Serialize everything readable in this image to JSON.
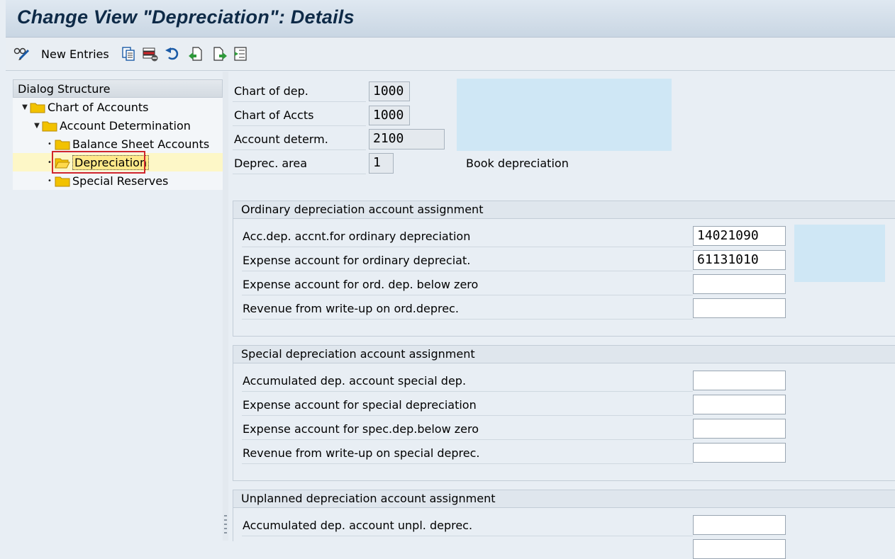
{
  "window": {
    "title": "Change View \"Depreciation\": Details"
  },
  "toolbar": {
    "new_entries_label": "New Entries",
    "icons": [
      "glasses-pencil-icon",
      "copy-icon",
      "delete-icon",
      "undo-icon",
      "export-icon",
      "previous-entry-icon",
      "next-entry-icon",
      "select-block-icon"
    ]
  },
  "tree": {
    "header": "Dialog Structure",
    "items": [
      {
        "label": "Chart of Accounts",
        "level": 0
      },
      {
        "label": "Account Determination",
        "level": 1
      },
      {
        "label": "Balance Sheet Accounts",
        "level": 2
      },
      {
        "label": "Depreciation",
        "level": 2,
        "selected": true
      },
      {
        "label": "Special Reserves",
        "level": 2
      }
    ]
  },
  "header_fields": {
    "chart_of_dep": {
      "label": "Chart of dep.",
      "value": "1000"
    },
    "chart_of_accts": {
      "label": "Chart of Accts",
      "value": "1000"
    },
    "account_determ": {
      "label": "Account determ.",
      "value": "2100"
    },
    "deprec_area": {
      "label": "Deprec. area",
      "value": "1",
      "description": "Book depreciation"
    }
  },
  "ordinary": {
    "title": "Ordinary depreciation account assignment",
    "rows": [
      {
        "label": "Acc.dep. accnt.for ordinary depreciation",
        "value": "14021090"
      },
      {
        "label": "Expense account for ordinary depreciat.",
        "value": "61131010"
      },
      {
        "label": "Expense account for ord. dep. below zero",
        "value": ""
      },
      {
        "label": "Revenue from write-up on ord.deprec.",
        "value": ""
      }
    ]
  },
  "special": {
    "title": "Special depreciation account assignment",
    "rows": [
      {
        "label": "Accumulated dep. account special dep.",
        "value": ""
      },
      {
        "label": "Expense account for special depreciation",
        "value": ""
      },
      {
        "label": "Expense account for spec.dep.below zero",
        "value": ""
      },
      {
        "label": "Revenue from write-up on special deprec.",
        "value": ""
      }
    ]
  },
  "unplanned": {
    "title": "Unplanned depreciation account assignment",
    "rows": [
      {
        "label": "Accumulated dep. account unpl. deprec.",
        "value": ""
      }
    ]
  },
  "colors": {
    "title_text": "#0e2a47",
    "selection_box": "#d0262a",
    "info_box": "#cfe7f5",
    "folder": "#f2c200"
  }
}
